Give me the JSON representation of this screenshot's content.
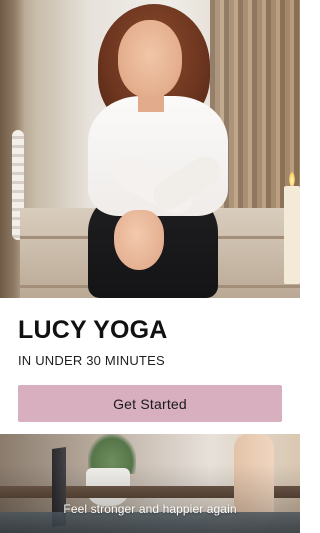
{
  "hero": {
    "image_description_icon": "photo-icon"
  },
  "brand": {
    "title": "LUCY YOGA",
    "subtitle": "IN UNDER 30 MINUTES"
  },
  "actions": {
    "get_started_label": "Get Started"
  },
  "preview": {
    "tagline": "Feel stronger and happier again"
  },
  "colors": {
    "accent": "#d7afbe",
    "title_text": "#111111",
    "background": "#ffffff"
  }
}
